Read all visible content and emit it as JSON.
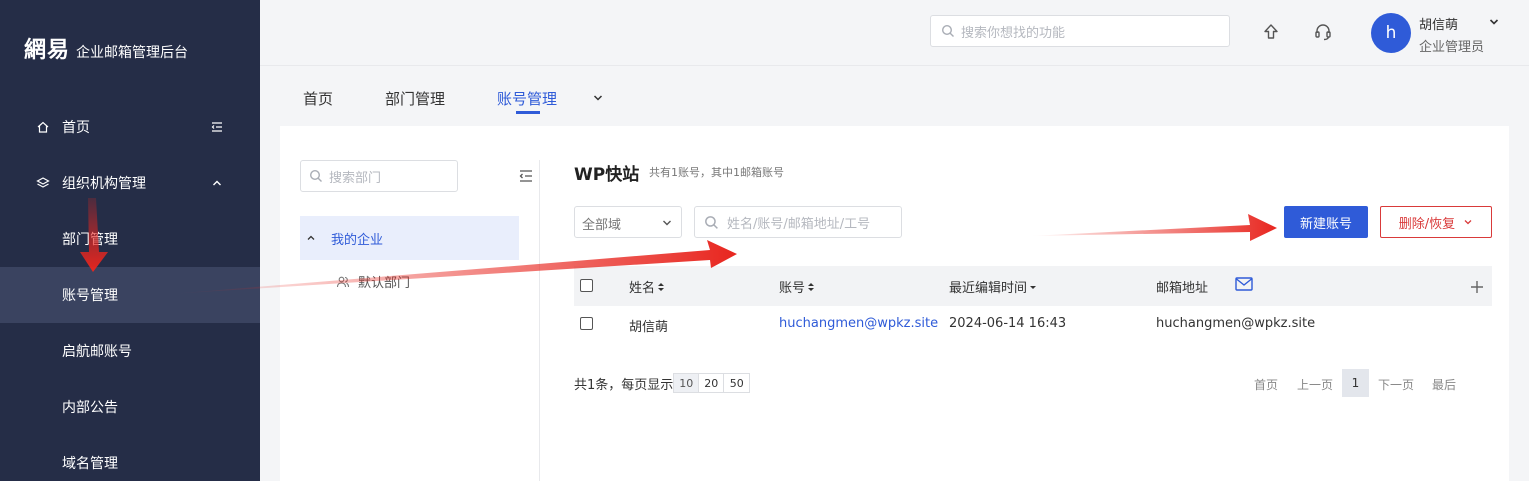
{
  "logo": {
    "mark": "網易",
    "text": "企业邮箱管理后台"
  },
  "sidebar": {
    "items": [
      {
        "label": "首页",
        "icon": "home-icon"
      },
      {
        "label": "组织机构管理",
        "icon": "layers-icon"
      },
      {
        "label": "部门管理"
      },
      {
        "label": "账号管理"
      },
      {
        "label": "启航邮账号"
      },
      {
        "label": "内部公告"
      },
      {
        "label": "域名管理"
      }
    ]
  },
  "header": {
    "search_placeholder": "搜索你想找的功能",
    "user": {
      "avatar_letter": "h",
      "name": "胡信萌",
      "role": "企业管理员"
    }
  },
  "tabs": [
    {
      "label": "首页"
    },
    {
      "label": "部门管理"
    },
    {
      "label": "账号管理"
    }
  ],
  "dept_panel": {
    "search_placeholder": "搜索部门",
    "root": "我的企业",
    "child": "默认部门"
  },
  "org": {
    "title": "WP快站",
    "subtitle": "共有1账号，其中1邮箱账号"
  },
  "filters": {
    "domain": "全部域",
    "search_placeholder": "姓名/账号/邮箱地址/工号"
  },
  "actions": {
    "new_label": "新建账号",
    "delete_label": "删除/恢复"
  },
  "table": {
    "columns": [
      "姓名",
      "账号",
      "最近编辑时间",
      "邮箱地址"
    ],
    "rows": [
      {
        "name": "胡信萌",
        "account": "huchangmen@wpkz.site",
        "edited": "2024-06-14 16:43",
        "email": "huchangmen@wpkz.site"
      }
    ]
  },
  "pagination": {
    "summary": "共1条，每页显示",
    "sizes": [
      "10",
      "20",
      "50"
    ],
    "first": "首页",
    "prev": "上一页",
    "current": "1",
    "next": "下一页",
    "last": "最后"
  },
  "colors": {
    "sidebar_bg": "#252d47",
    "accent": "#2f5bd8",
    "danger": "#d93a3a",
    "arrow": "#e8261f"
  }
}
